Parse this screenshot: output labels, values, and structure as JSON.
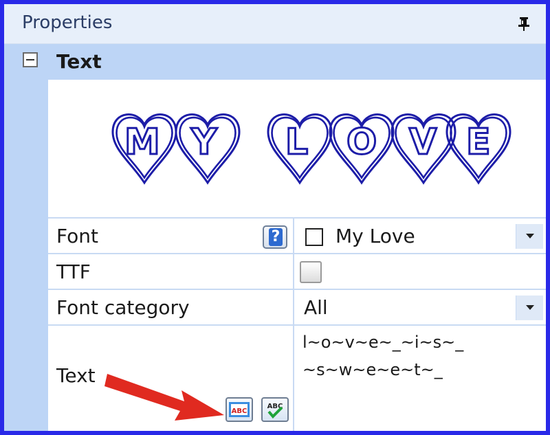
{
  "panel": {
    "title": "Properties"
  },
  "category": {
    "label": "Text"
  },
  "preview": {
    "text": "MY LOVE"
  },
  "rows": {
    "font": {
      "label": "Font",
      "value": "My Love"
    },
    "ttf": {
      "label": "TTF",
      "checked": false
    },
    "font_category": {
      "label": "Font category",
      "value": "All"
    },
    "text": {
      "label": "Text",
      "line1": "l~o~v~e~_~i~s~_",
      "line2": "~s~w~e~e~t~_"
    }
  },
  "buttons": {
    "style_text_button_label": "ABC",
    "spellcheck_button_label": "ABC"
  },
  "colors": {
    "frame": "#2929e8",
    "header_bg": "#e7effa",
    "category_bg": "#bdd5f6",
    "preview_stroke": "#1d1da8",
    "arrow": "#e02a20"
  },
  "icons": {
    "pin": "pin-icon",
    "help": "help-icon",
    "collapse": "minus-collapse-icon",
    "dropdown": "chevron-down-icon"
  }
}
